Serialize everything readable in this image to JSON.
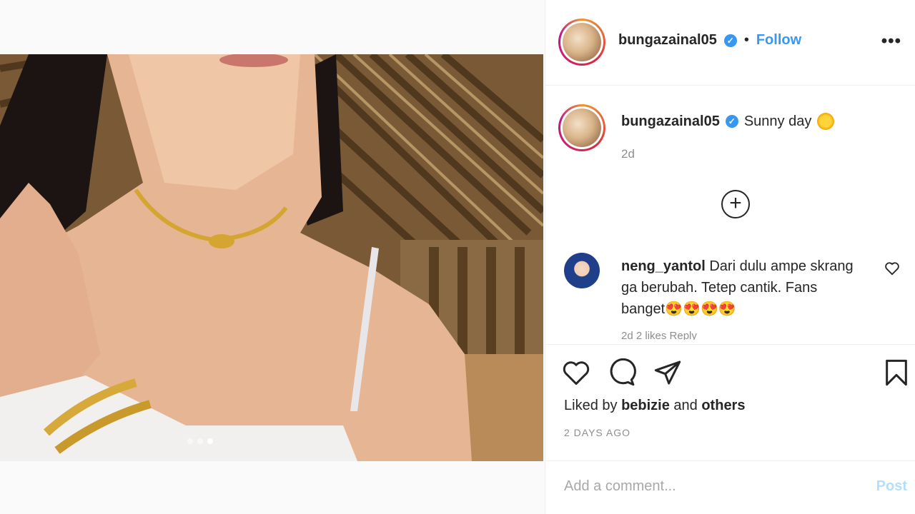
{
  "post": {
    "username": "bungazainal05",
    "follow_label": "Follow",
    "bullet": "•",
    "more_label": "•••",
    "caption": "Sunny day",
    "caption_time": "2d",
    "carousel": {
      "total": 3,
      "active_index": 2
    }
  },
  "comment": {
    "username": "neng_yantol",
    "text": "Dari dulu ampe skrang ga berubah. Tetep cantik. Fans banget😍😍😍😍",
    "meta": "2d   2 likes   Reply"
  },
  "actions": {
    "liked_by_prefix": "Liked by ",
    "liked_by_user": "bebizie",
    "liked_by_mid": " and ",
    "liked_by_others": "others",
    "posted": "2 DAYS AGO"
  },
  "add_comment": {
    "placeholder": "Add a comment...",
    "post_label": "Post"
  },
  "colors": {
    "accent": "#3897f0",
    "muted": "#8e8e8e",
    "post_disabled": "#b2dffc"
  },
  "icons": [
    "more-icon",
    "verified-icon",
    "add-icon",
    "heart-icon",
    "comment-icon",
    "share-icon",
    "bookmark-icon"
  ]
}
